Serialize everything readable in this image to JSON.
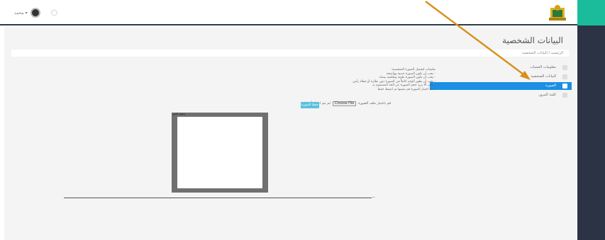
{
  "header": {
    "user_name": "محمد ▾",
    "bell_icon": "bell-icon",
    "logo_icon": "emblem-logo"
  },
  "page": {
    "title": "البيانات الشخصية",
    "breadcrumb": "الرئيسية / البيانات الشخصية"
  },
  "menu": {
    "items": [
      {
        "label": "معلومات الحساب",
        "icon": "user-icon",
        "active": false
      },
      {
        "label": "البيانات الشخصية",
        "icon": "card-icon",
        "active": false
      },
      {
        "label": "الصورة",
        "icon": "image-icon",
        "active": true
      },
      {
        "label": "كلمة المرور",
        "icon": "lock-icon",
        "active": false
      }
    ]
  },
  "upload": {
    "instructions": [
      "تعليمات لتحميل الصورة الشخصية:",
      "- يجب أن تكون الصورة حديثة وواضحة",
      "- يجب أن تكون الصورة ملونة وبخلفية بيضاء",
      "- يجب أن يظهر الوجه كاملاً في الصورة دون نظارة أو غطاء رأس",
      "- يجب ألا يزيد حجم الصورة عن الحد المسموح به",
      "- بعد اختيار الصورة قم بقصها ثم اضغط حفظ"
    ],
    "label": "قم باختيار ملف الصورة",
    "choose_button": "Choose File",
    "no_file_text": "لم يتم اختيار أي ملف",
    "save_button": "حفظ الصورة",
    "crop_label": "منطقة القص"
  },
  "colors": {
    "active_menu": "#1a8fe3",
    "sidebar": "#2b3345",
    "accent_green": "#1abc9c",
    "arrow": "#d9901a"
  }
}
